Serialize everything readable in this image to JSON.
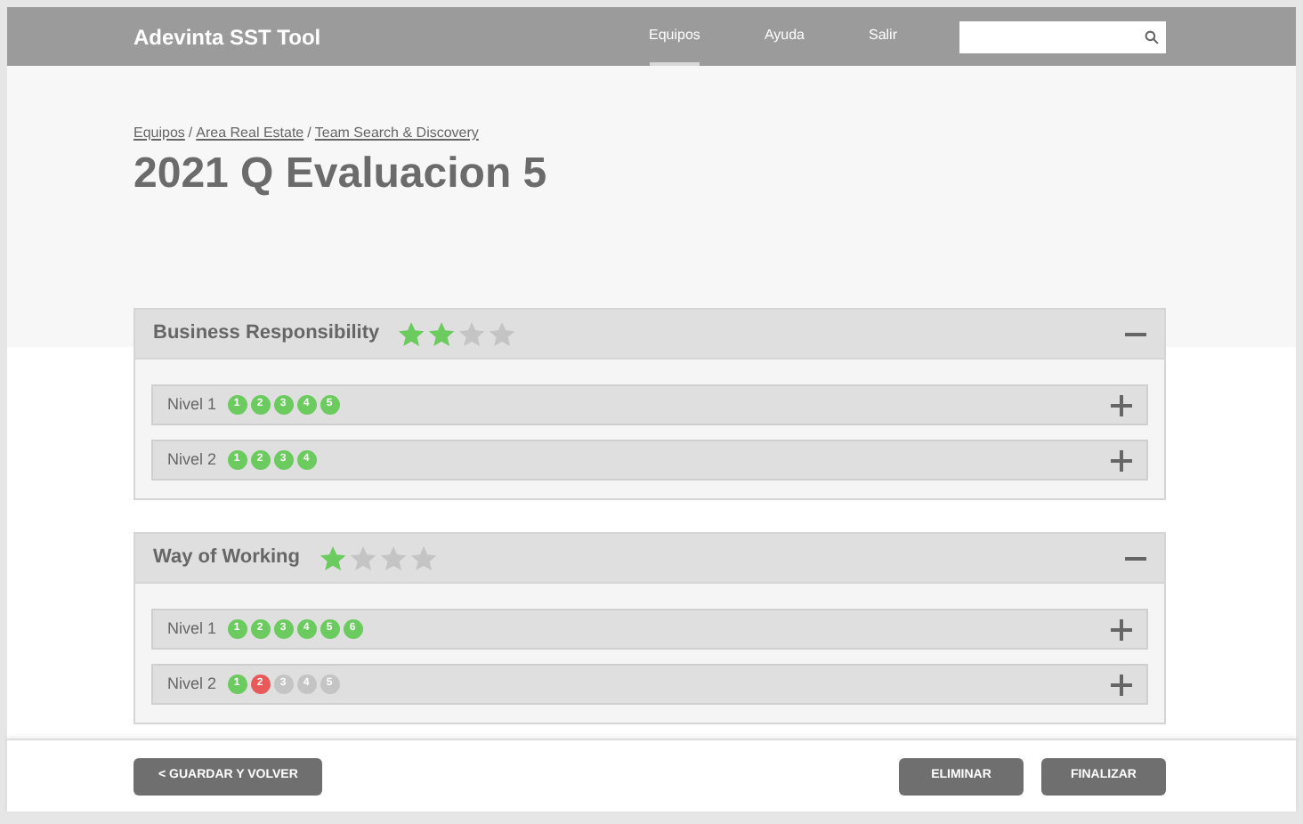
{
  "header": {
    "title": "Adevinta SST Tool",
    "nav": [
      {
        "label": "Equipos",
        "selected": true
      },
      {
        "label": "Ayuda",
        "selected": false
      },
      {
        "label": "Salir",
        "selected": false
      }
    ]
  },
  "breadcrumb": [
    {
      "label": "Equipos"
    },
    {
      "separator": "/",
      "label": "Area Real Estate"
    },
    {
      "separator": "/",
      "label": "Team Search & Discovery"
    }
  ],
  "title": "2021 Q Evaluacion 5",
  "sections": [
    {
      "title": "Business Responsibility",
      "stars": 2,
      "expanded": true,
      "levels": [
        {
          "label": "Nivel 1",
          "expanded": false,
          "dots": [
            {
              "text": "1",
              "color": "#6ccb5f"
            },
            {
              "text": "2",
              "color": "#6ccb5f"
            },
            {
              "text": "3",
              "color": "#6ccb5f"
            },
            {
              "text": "4",
              "color": "#6ccb5f"
            },
            {
              "text": "5",
              "color": "#6ccb5f"
            }
          ]
        },
        {
          "label": "Nivel 2",
          "expanded": false,
          "dots": [
            {
              "text": "1",
              "color": "#6ccb5f"
            },
            {
              "text": "2",
              "color": "#6ccb5f"
            },
            {
              "text": "3",
              "color": "#6ccb5f"
            },
            {
              "text": "4",
              "color": "#6ccb5f"
            }
          ]
        }
      ]
    },
    {
      "title": "Way of Working",
      "stars": 1,
      "expanded": true,
      "levels": [
        {
          "label": "Nivel 1",
          "expanded": false,
          "dots": [
            {
              "text": "1",
              "color": "#6ccb5f"
            },
            {
              "text": "2",
              "color": "#6ccb5f"
            },
            {
              "text": "3",
              "color": "#6ccb5f"
            },
            {
              "text": "4",
              "color": "#6ccb5f"
            },
            {
              "text": "5",
              "color": "#6ccb5f"
            },
            {
              "text": "6",
              "color": "#6ccb5f"
            }
          ]
        },
        {
          "label": "Nivel 2",
          "expanded": false,
          "dots": [
            {
              "text": "1",
              "color": "#6ccb5f"
            },
            {
              "text": "2",
              "color": "#e85a5a"
            },
            {
              "text": "3",
              "color": "#c4c4c4"
            },
            {
              "text": "4",
              "color": "#c4c4c4"
            },
            {
              "text": "5",
              "color": "#c4c4c4"
            }
          ]
        }
      ]
    }
  ],
  "footer": {
    "left": "< GUARDAR Y VOLVER",
    "right": [
      "ELIMINAR",
      "FINALIZAR"
    ]
  }
}
